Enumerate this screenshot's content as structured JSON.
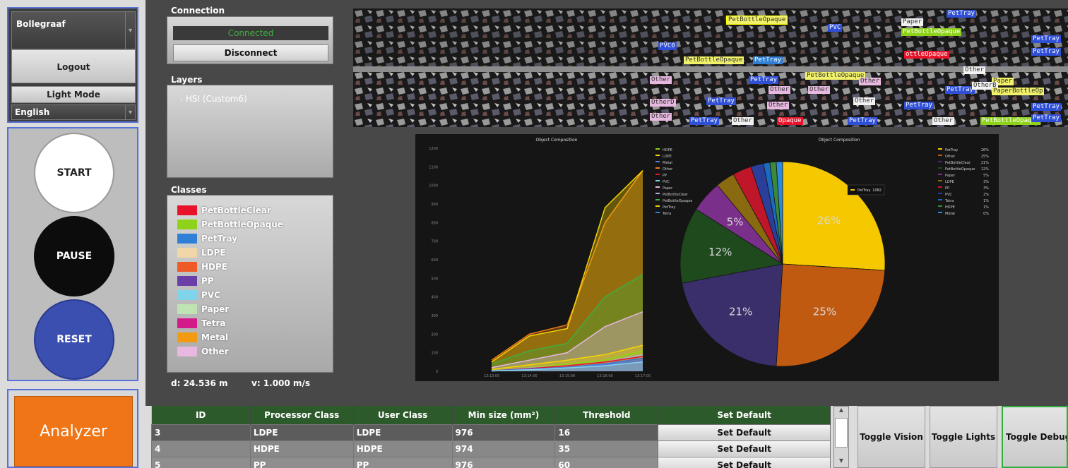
{
  "left": {
    "site": "Bollegraaf",
    "logout": "Logout",
    "light_mode": "Light Mode",
    "language": "English",
    "start": "START",
    "pause": "PAUSE",
    "reset": "RESET",
    "analyzer": "Analyzer"
  },
  "connection": {
    "title": "Connection",
    "status": "Connected",
    "disconnect": "Disconnect"
  },
  "layers": {
    "title": "Layers",
    "items": [
      "HSI (Custom6)"
    ]
  },
  "classes": {
    "title": "Classes",
    "items": [
      {
        "name": "PetBottleClear",
        "color": "#e8132a"
      },
      {
        "name": "PetBottleOpaque",
        "color": "#8fd21a"
      },
      {
        "name": "PetTray",
        "color": "#2f7fd6"
      },
      {
        "name": "LDPE",
        "color": "#f1d7a8"
      },
      {
        "name": "HDPE",
        "color": "#ef5a26"
      },
      {
        "name": "PP",
        "color": "#6a3fa8"
      },
      {
        "name": "PVC",
        "color": "#7fd3ea"
      },
      {
        "name": "Paper",
        "color": "#bfe3b3"
      },
      {
        "name": "Tetra",
        "color": "#d41a8a"
      },
      {
        "name": "Metal",
        "color": "#f29a10"
      },
      {
        "name": "Other",
        "color": "#e7b8e0"
      }
    ]
  },
  "status": {
    "distance": "d: 24.536 m",
    "velocity": "v: 1.000 m/s"
  },
  "detections": [
    "PetBottleOpaque",
    "PetTray",
    "Paper",
    "PVC",
    "PetBottleOpaque",
    "PVC0",
    "PetBottleOpaque",
    "PetTray",
    "ottleOpaque",
    "PetTray",
    "Other",
    "Other",
    "PetTray",
    "PetBottleOpaque",
    "Other",
    "Paper",
    "PetTray",
    "Other",
    "OtherD",
    "PetTray",
    "Other",
    "Other",
    "PetTray",
    "Other",
    "Opaque",
    "PetTray",
    "PetBottleOpaque",
    "Other",
    "PetTray",
    "Other",
    "PetTray",
    "PetTray",
    "Other",
    "OtherB",
    "PaperBottleOp",
    "PetTray"
  ],
  "chart_data": [
    {
      "type": "area",
      "title": "Object Composition",
      "x": [
        "13:13:00",
        "13:14:00",
        "13:15:00",
        "13:16:00",
        "13:17:00"
      ],
      "ylim": [
        0,
        1200
      ],
      "yticks": [
        0,
        100,
        200,
        300,
        400,
        500,
        600,
        700,
        800,
        900,
        1000,
        1100,
        1200
      ],
      "legend_position": "right",
      "series": [
        {
          "name": "HDPE",
          "color": "#8fd21a",
          "values": [
            5,
            20,
            40,
            60,
            110
          ]
        },
        {
          "name": "LDPE",
          "color": "#f5d400",
          "values": [
            10,
            35,
            60,
            90,
            140
          ]
        },
        {
          "name": "Metal",
          "color": "#5a7ad6",
          "values": [
            2,
            10,
            20,
            35,
            60
          ]
        },
        {
          "name": "Other",
          "color": "#ef7a1a",
          "values": [
            60,
            200,
            250,
            800,
            1080
          ]
        },
        {
          "name": "PP",
          "color": "#e8132a",
          "values": [
            3,
            15,
            30,
            50,
            80
          ]
        },
        {
          "name": "PVC",
          "color": "#7fd3ea",
          "values": [
            2,
            8,
            18,
            30,
            50
          ]
        },
        {
          "name": "Paper",
          "color": "#e7b8e0",
          "values": [
            20,
            60,
            100,
            240,
            320
          ]
        },
        {
          "name": "PetBottleClear",
          "color": "#b0b0d8",
          "values": [
            4,
            18,
            30,
            50,
            90
          ]
        },
        {
          "name": "PetBottleOpaque",
          "color": "#3fae3f",
          "values": [
            40,
            110,
            150,
            400,
            520
          ]
        },
        {
          "name": "PetTray",
          "color": "#f5d400",
          "values": [
            50,
            190,
            230,
            880,
            1080
          ]
        },
        {
          "name": "Tetra",
          "color": "#2f7fd6",
          "values": [
            3,
            12,
            22,
            40,
            70
          ]
        }
      ]
    },
    {
      "type": "pie",
      "title": "Object Composition",
      "legend_position": "right",
      "tooltip": {
        "label": "PetTray",
        "value": "1082"
      },
      "slices": [
        {
          "name": "PetTray",
          "value": 26,
          "label": "26%",
          "color": "#f5c800"
        },
        {
          "name": "Other",
          "value": 25,
          "label": "25%",
          "color": "#c05a10"
        },
        {
          "name": "PetBottleClear",
          "value": 21,
          "label": "21%",
          "color": "#3b2f6b"
        },
        {
          "name": "PetBottleOpaque",
          "value": 12,
          "label": "12%",
          "color": "#1e4a1e"
        },
        {
          "name": "Paper",
          "value": 5,
          "label": "5%",
          "color": "#7a2f8a"
        },
        {
          "name": "LDPE",
          "value": 3,
          "label": "",
          "color": "#8a6a10"
        },
        {
          "name": "PP",
          "value": 3,
          "label": "",
          "color": "#c0162a"
        },
        {
          "name": "PVC",
          "value": 2,
          "label": "",
          "color": "#2a3f9a"
        },
        {
          "name": "Tetra",
          "value": 1,
          "label": "",
          "color": "#1a6ac0"
        },
        {
          "name": "HDPE",
          "value": 1,
          "label": "",
          "color": "#3a8a3a"
        },
        {
          "name": "Metal",
          "value": 1,
          "label": "",
          "color": "#2a8ae0"
        }
      ],
      "legend": [
        {
          "name": "PetTray",
          "pct": "26%"
        },
        {
          "name": "Other",
          "pct": "25%"
        },
        {
          "name": "PetBottleClear",
          "pct": "21%"
        },
        {
          "name": "PetBottleOpaque",
          "pct": "12%"
        },
        {
          "name": "Paper",
          "pct": "5%"
        },
        {
          "name": "LDPE",
          "pct": "3%"
        },
        {
          "name": "PP",
          "pct": "3%"
        },
        {
          "name": "PVC",
          "pct": "2%"
        },
        {
          "name": "Tetra",
          "pct": "1%"
        },
        {
          "name": "HDPE",
          "pct": "1%"
        },
        {
          "name": "Metal",
          "pct": "0%"
        }
      ]
    }
  ],
  "table": {
    "headers": [
      "ID",
      "Processor Class",
      "User Class",
      "Min size (mm²)",
      "Threshold",
      "Set Default"
    ],
    "rows": [
      [
        "3",
        "LDPE",
        "LDPE",
        "976",
        "16",
        "Set Default"
      ],
      [
        "4",
        "HDPE",
        "HDPE",
        "974",
        "35",
        "Set Default"
      ],
      [
        "5",
        "PP",
        "PP",
        "976",
        "60",
        "Set Default"
      ]
    ]
  },
  "toggles": {
    "vision": "Toggle Vision",
    "lights": "Toggle Lights",
    "debug": "Toggle Debug"
  }
}
